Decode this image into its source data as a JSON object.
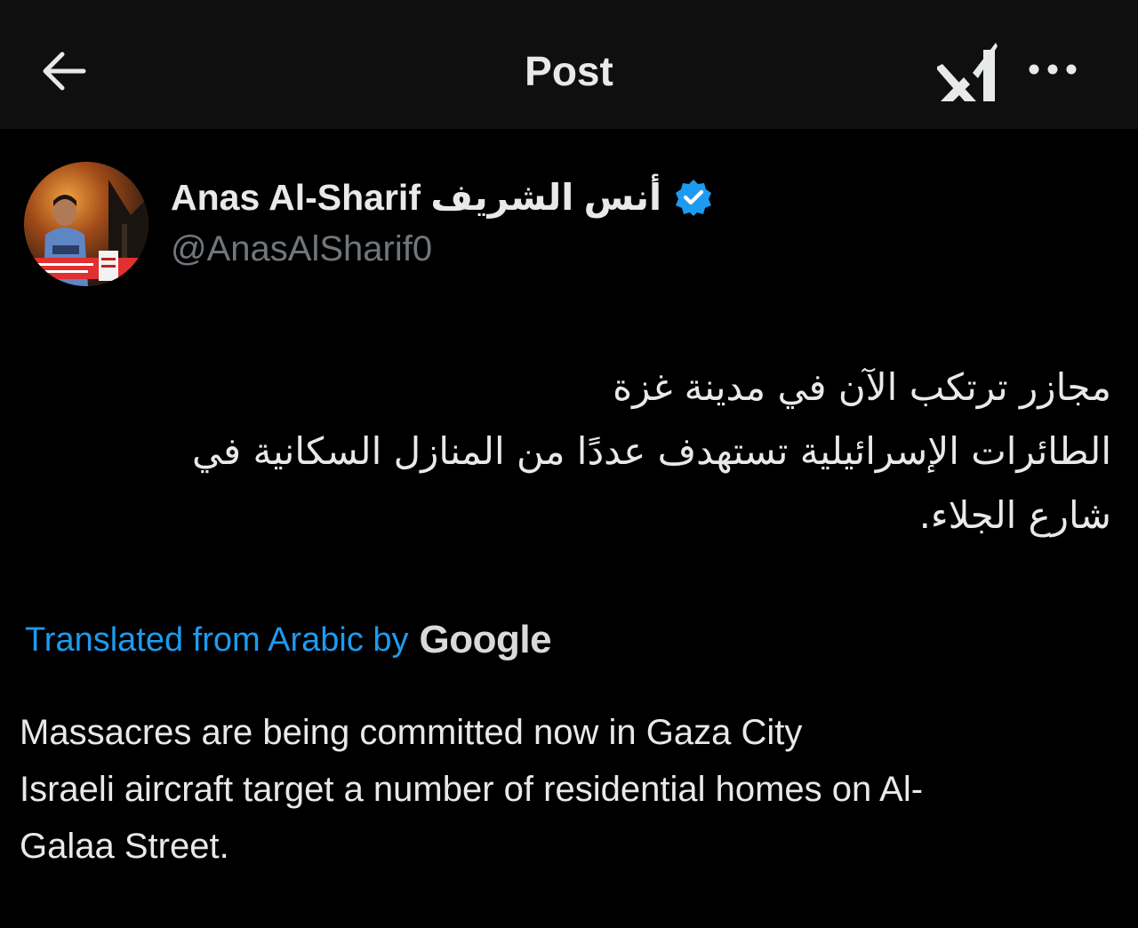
{
  "header": {
    "title": "Post",
    "back_icon": "arrow-left-icon",
    "grok_icon": "grok-icon",
    "more_icon": "more-horizontal-icon"
  },
  "author": {
    "display_name": "Anas Al-Sharif أنس الشريف",
    "handle": "@AnasAlSharif0",
    "verified": true,
    "verified_color": "#1d9bf0"
  },
  "post": {
    "arabic_lines": [
      "مجازر ترتكب الآن في مدينة غزة",
      "الطائرات الإسرائيلية تستهدف عددًا من المنازل السكانية في",
      "شارع الجلاء."
    ],
    "translation_label": "Translated from Arabic by",
    "translation_provider": "Google",
    "english_lines": [
      "Massacres are being committed now in Gaza City",
      "Israeli aircraft target a number of residential homes on Al-",
      "Galaa Street."
    ]
  },
  "colors": {
    "background": "#000000",
    "header_background": "#0f0f0f",
    "text": "#e7e9ea",
    "secondary_text": "#71767b",
    "link": "#1d9bf0"
  }
}
